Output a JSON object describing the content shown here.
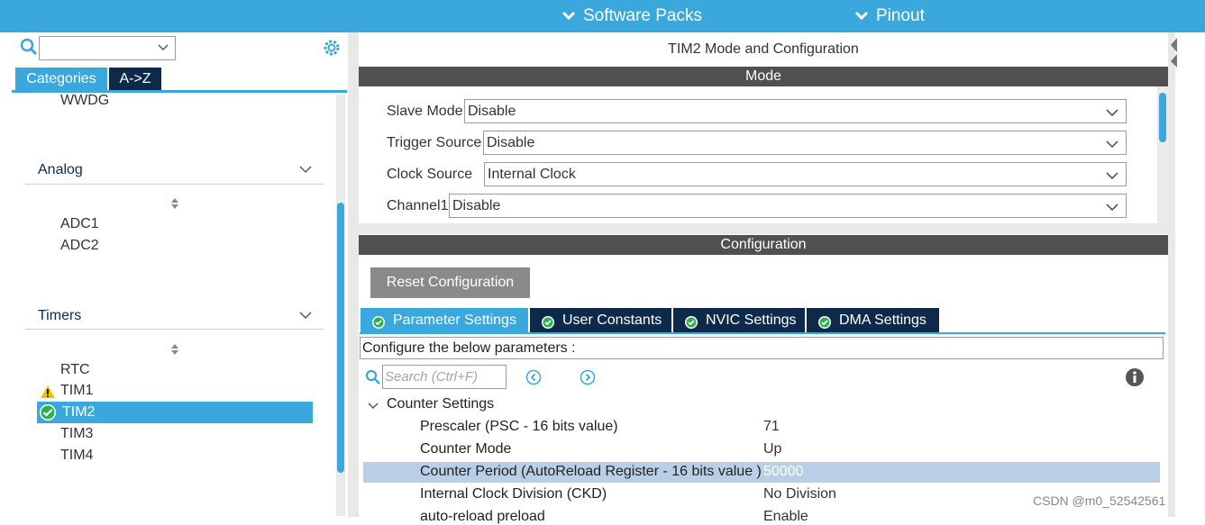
{
  "topbar": {
    "menus": [
      "Software Packs",
      "Pinout"
    ],
    "color": "#3aa8dc"
  },
  "left": {
    "search_value": "",
    "tabs": [
      "Categories",
      "A->Z"
    ],
    "items_top": [
      "WWDG"
    ],
    "groups": [
      {
        "name": "Analog",
        "items": [
          "ADC1",
          "ADC2"
        ]
      },
      {
        "name": "Timers",
        "items": [
          "RTC",
          "TIM1",
          "TIM2",
          "TIM3",
          "TIM4"
        ]
      }
    ],
    "selected_item": "TIM2",
    "warning_item": "TIM1"
  },
  "right": {
    "title": "TIM2 Mode and Configuration",
    "mode_header": "Mode",
    "mode_fields": [
      {
        "label": "Slave Mode",
        "value": "Disable"
      },
      {
        "label": "Trigger Source",
        "value": "Disable"
      },
      {
        "label": "Clock Source",
        "value": "Internal Clock"
      },
      {
        "label": "Channel1",
        "value": "Disable"
      }
    ],
    "config_header": "Configuration",
    "reset_label": "Reset Configuration",
    "config_tabs": [
      "Parameter Settings",
      "User Constants",
      "NVIC Settings",
      "DMA Settings"
    ],
    "active_tab": "Parameter Settings",
    "hint": "Configure the below parameters :",
    "search_placeholder": "Search (Ctrl+F)",
    "group_title": "Counter Settings",
    "params": [
      {
        "label": "Prescaler (PSC - 16 bits value)",
        "value": "71"
      },
      {
        "label": "Counter Mode",
        "value": "Up"
      },
      {
        "label": "Counter Period (AutoReload Register - 16 bits value )",
        "value": "50000"
      },
      {
        "label": "Internal Clock Division (CKD)",
        "value": "No Division"
      },
      {
        "label": "auto-reload preload",
        "value": "Enable"
      }
    ]
  },
  "watermark": "CSDN @m0_52542561",
  "colors": {
    "accent": "#3aa8dc",
    "navy": "#0e2a4b",
    "header_gray": "#505050",
    "highlight": "#b8cfe6"
  }
}
